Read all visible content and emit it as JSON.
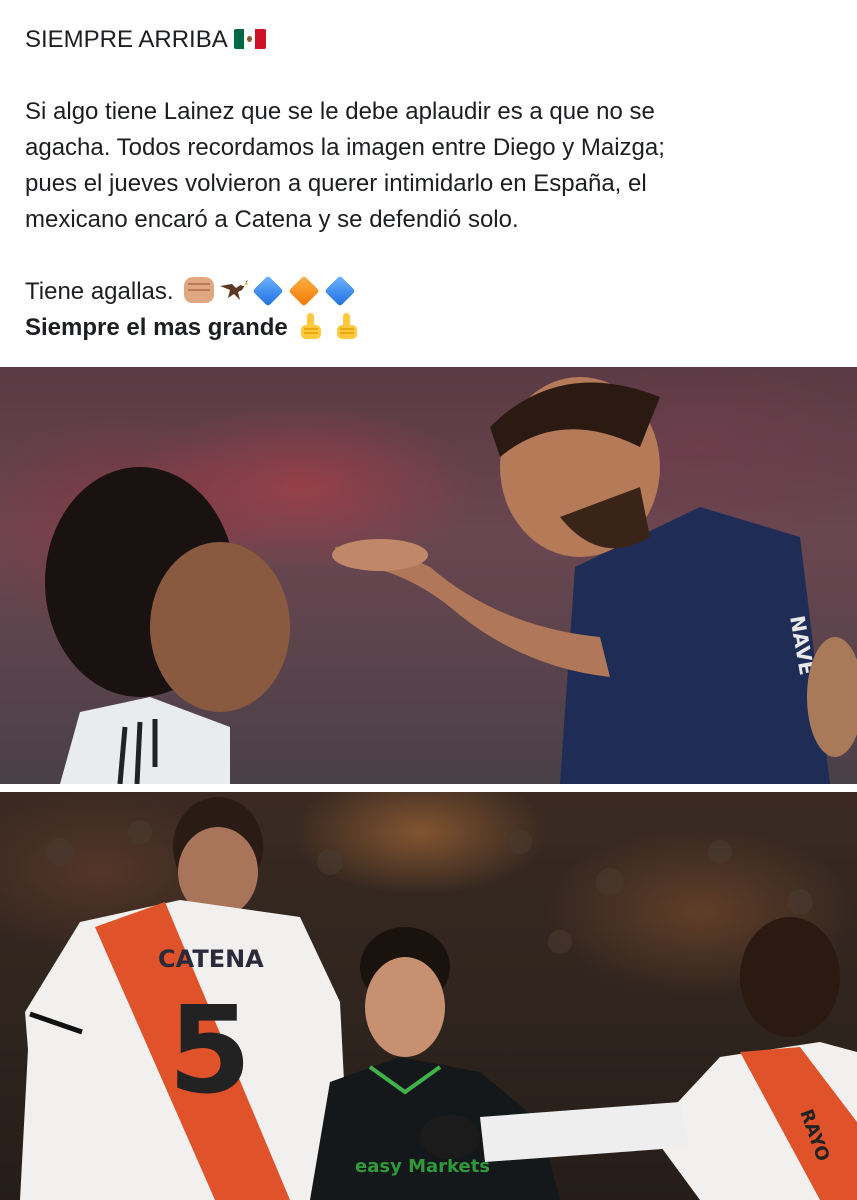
{
  "post": {
    "title": "SIEMPRE ARRIBA",
    "title_emoji": "mexico-flag",
    "paragraph_lines": [
      "Si algo tiene Lainez que se le debe aplaudir es a que no se",
      "agacha. Todos recordamos la imagen entre Diego y Maizga;",
      "pues el jueves volvieron a querer intimidarlo en España, el",
      "mexicano encaró a Catena y se defendió solo."
    ],
    "closing_line": "Tiene agallas.",
    "closing_emojis": [
      "fist-icon",
      "eagle-icon",
      "blue-diamond-icon",
      "orange-diamond-icon",
      "blue-diamond-icon"
    ],
    "bold_line": "Siempre el mas grande",
    "bold_emojis": [
      "thumbs-up-icon",
      "thumbs-up-icon"
    ]
  },
  "photos": {
    "top": {
      "description_icon": "photo-confrontation-1"
    },
    "bottom": {
      "jersey_name": "CATENA",
      "jersey_number": "5",
      "sponsor_text": "easy Markets",
      "right_jersey_name": "RAYO"
    }
  },
  "colors": {
    "text": "#1c1e21",
    "background": "#ffffff"
  }
}
